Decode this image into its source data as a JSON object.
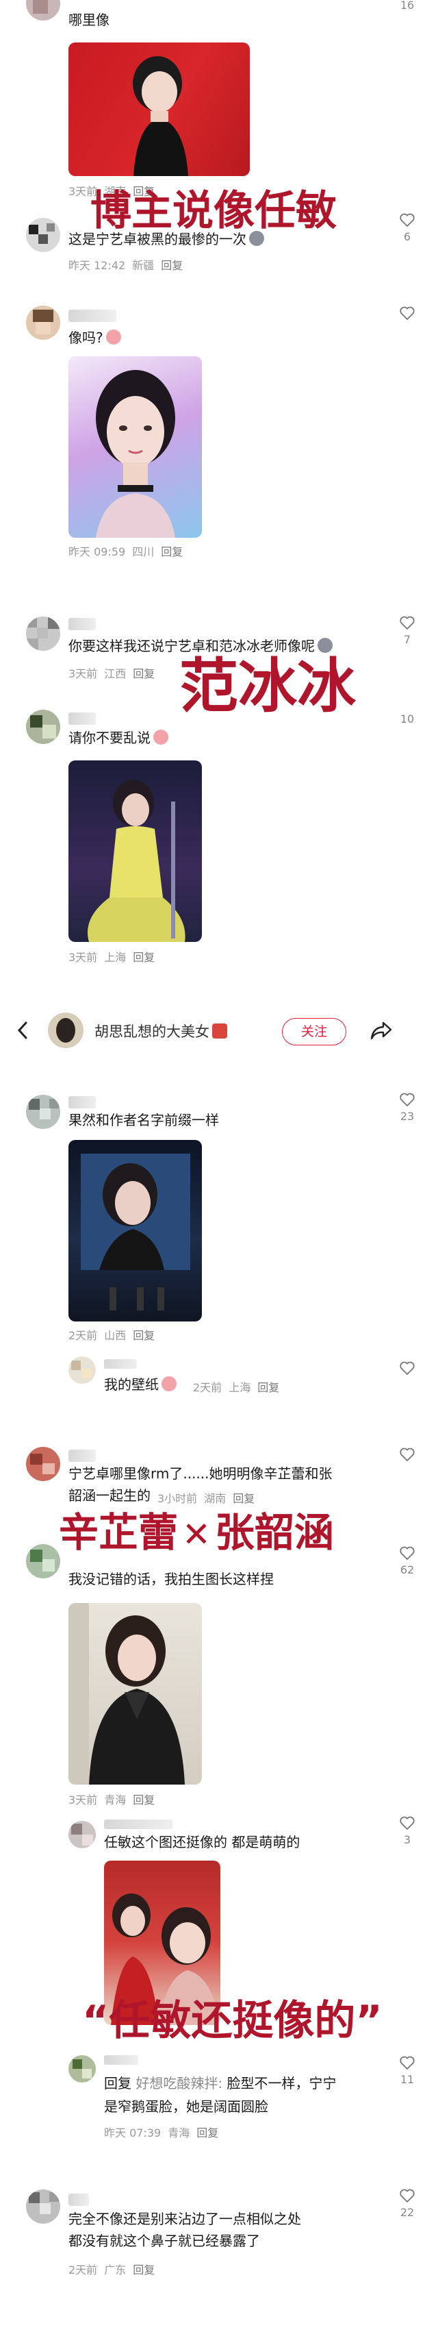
{
  "colors": {
    "overlay_red": "#b0162b",
    "meta_grey": "#9a9a9a",
    "follow_red": "#e0203a"
  },
  "top_comment": {
    "text": "哪里像",
    "likes": "16",
    "meta": {
      "time": "3天前",
      "location": "湖南",
      "reply": "回复"
    }
  },
  "overlay1": "博主说像任敏",
  "c2": {
    "text": "这是宁艺卓被黑的最惨的一次",
    "likes": "6",
    "meta": {
      "time": "昨天 12:42",
      "location": "新疆",
      "reply": "回复"
    }
  },
  "c3": {
    "text": "像吗?",
    "meta": {
      "time": "昨天 09:59",
      "location": "四川",
      "reply": "回复"
    }
  },
  "c4": {
    "text": "你要这样我还说宁艺卓和范冰冰老师像呢",
    "likes": "7",
    "meta": {
      "time": "3天前",
      "location": "江西",
      "reply": "回复"
    }
  },
  "overlay2": "范冰冰",
  "c5": {
    "text": "请你不要乱说",
    "likes": "10",
    "meta": {
      "time": "3天前",
      "location": "上海",
      "reply": "回复"
    }
  },
  "header": {
    "author": "胡思乱想的大美女",
    "follow": "关注",
    "back_icon": "back-arrow-icon",
    "share_icon": "share-icon"
  },
  "c6": {
    "text": "果然和作者名字前缀一样",
    "likes": "23",
    "meta": {
      "time": "2天前",
      "location": "山西",
      "reply": "回复"
    }
  },
  "c6r": {
    "text": "我的壁纸",
    "meta": {
      "time": "2天前",
      "location": "上海",
      "reply": "回复"
    }
  },
  "c7": {
    "text_line1": "宁艺卓哪里像rm了......她明明像辛芷蕾和张",
    "text_line2": "韶涵一起生的",
    "meta": {
      "time": "3小时前",
      "location": "湖南",
      "reply": "回复"
    }
  },
  "overlay3": {
    "left": "辛芷蕾",
    "cross": "✕",
    "right": "张韶涵"
  },
  "c8": {
    "text": "我没记错的话，我拍生图长这样捏",
    "likes": "62",
    "meta": {
      "time": "3天前",
      "location": "青海",
      "reply": "回复"
    }
  },
  "c8r": {
    "text": "任敏这个图还挺像的 都是萌萌的",
    "likes": "3"
  },
  "overlay4": "“任敏还挺像的”",
  "c8r2": {
    "reply_prefix": "回复",
    "reply_to": "好想吃酸辣拌:",
    "text_line1": "脸型不一样，宁宁",
    "text_line2": "是窄鹅蛋脸，她是阔面圆脸",
    "likes": "11",
    "meta": {
      "time": "昨天 07:39",
      "location": "青海",
      "reply": "回复"
    }
  },
  "c9": {
    "text_line1": "完全不像还是别来沾边了一点相似之处",
    "text_line2": "都没有就这个鼻子就已经暴露了",
    "likes": "22",
    "meta": {
      "time": "2天前",
      "location": "广东",
      "reply": "回复"
    }
  }
}
